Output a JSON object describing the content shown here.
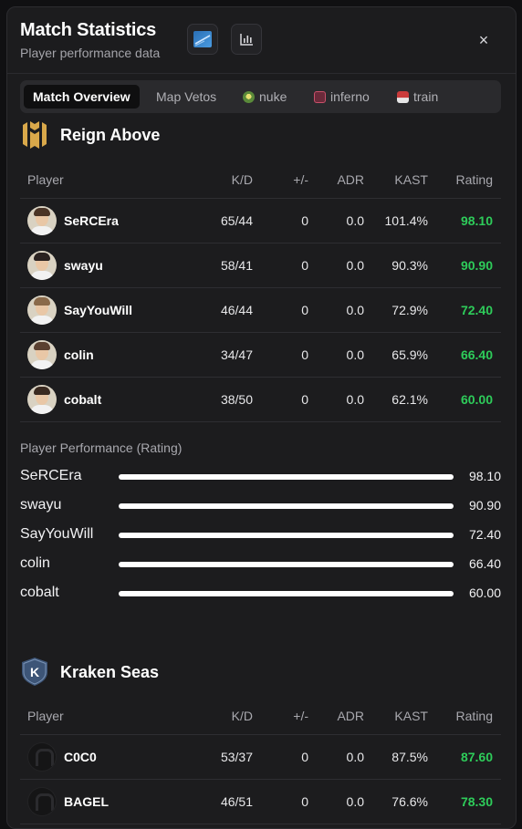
{
  "header": {
    "title": "Match Statistics",
    "subtitle": "Player performance data",
    "close_glyph": "×"
  },
  "tabs": [
    {
      "label": "Match Overview",
      "active": true
    },
    {
      "label": "Map Vetos",
      "active": false
    },
    {
      "label": "nuke",
      "icon": "nuke-map-icon",
      "active": false
    },
    {
      "label": "inferno",
      "icon": "inferno-map-icon",
      "active": false
    },
    {
      "label": "train",
      "icon": "train-map-icon",
      "active": false
    }
  ],
  "columns": {
    "player": "Player",
    "kd": "K/D",
    "pm": "+/-",
    "adr": "ADR",
    "kast": "KAST",
    "rating": "Rating"
  },
  "teams": [
    {
      "name": "Reign Above",
      "logo": "reign-above-logo-icon",
      "logo_color": "#d9a84a",
      "players": [
        {
          "name": "SeRCEra",
          "kd": "65/44",
          "pm": "0",
          "adr": "0.0",
          "kast": "101.4%",
          "rating": "98.10"
        },
        {
          "name": "swayu",
          "kd": "58/41",
          "pm": "0",
          "adr": "0.0",
          "kast": "90.3%",
          "rating": "90.90"
        },
        {
          "name": "SayYouWill",
          "kd": "46/44",
          "pm": "0",
          "adr": "0.0",
          "kast": "72.9%",
          "rating": "72.40"
        },
        {
          "name": "colin",
          "kd": "34/47",
          "pm": "0",
          "adr": "0.0",
          "kast": "65.9%",
          "rating": "66.40"
        },
        {
          "name": "cobalt",
          "kd": "38/50",
          "pm": "0",
          "adr": "0.0",
          "kast": "62.1%",
          "rating": "60.00"
        }
      ],
      "performance": {
        "title": "Player Performance (Rating)",
        "bars": [
          {
            "name": "SeRCEra",
            "value": "98.10",
            "fill": 1.0
          },
          {
            "name": "swayu",
            "value": "90.90",
            "fill": 1.0
          },
          {
            "name": "SayYouWill",
            "value": "72.40",
            "fill": 1.0
          },
          {
            "name": "colin",
            "value": "66.40",
            "fill": 1.0
          },
          {
            "name": "cobalt",
            "value": "60.00",
            "fill": 1.0
          }
        ]
      }
    },
    {
      "name": "Kraken Seas",
      "logo": "kraken-seas-logo-icon",
      "logo_letter": "K",
      "logo_color": "#3d5577",
      "players": [
        {
          "name": "C0C0",
          "kd": "53/37",
          "pm": "0",
          "adr": "0.0",
          "kast": "87.5%",
          "rating": "87.60"
        },
        {
          "name": "BAGEL",
          "kd": "46/51",
          "pm": "0",
          "adr": "0.0",
          "kast": "76.6%",
          "rating": "78.30"
        }
      ]
    }
  ],
  "colors": {
    "rating_green": "#2ecc5a",
    "panel": "#1c1c1e",
    "background": "#101012"
  }
}
